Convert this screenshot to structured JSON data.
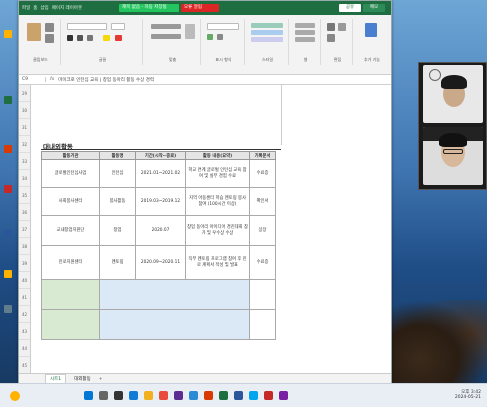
{
  "window": {
    "title_cells": [
      "파일",
      "홈",
      "삽입",
      "페이지 레이아웃",
      "수식",
      "데이터",
      "검토",
      "보기",
      "자동화",
      "도움말"
    ],
    "toast_green": "제목 없음 - 자동 저장됨",
    "toast_red": "오류 알림",
    "share_label": "공유",
    "comment_label": "메모"
  },
  "ribbon": {
    "groups": [
      "클립보드",
      "글꼴",
      "맞춤",
      "표시 형식",
      "스타일",
      "셀",
      "편집",
      "추가 기능"
    ]
  },
  "formula_bar": {
    "name_box": "C9",
    "content": "마이크로 인턴십 교육 | 창업 동아리 활동 수상 경력"
  },
  "sheet": {
    "title": "대내외활동",
    "headers": [
      "활동기관",
      "활동명",
      "기간(시작~종료)",
      "활동 내용(요약)",
      "기록문서"
    ],
    "rows": [
      {
        "org": "글로벌인턴십사업",
        "name": "인턴십",
        "period": "2021.01~2021.02",
        "desc": "학교 연계 글로벌 인턴십 교육 참여 및 실무 경험 수료",
        "doc": "수료증"
      },
      {
        "org": "사회봉사센터",
        "name": "봉사활동",
        "period": "2019.03~2019.12",
        "desc": "지역 아동센터 학습 멘토링 봉사 참여 (100시간 이상)",
        "doc": "확인서"
      },
      {
        "org": "교내창업지원단",
        "name": "창업",
        "period": "2020.07",
        "desc": "창업 동아리 아이디어 경진대회 참가 및 우수상 수상",
        "doc": "상장"
      },
      {
        "org": "진로지원센터",
        "name": "멘토링",
        "period": "2020.09~2020.11",
        "desc": "직무 멘토링 프로그램 참여 후 진로 계획서 작성 및 발표",
        "doc": "수료증"
      }
    ],
    "row_numbers": [
      "29",
      "30",
      "31",
      "32",
      "33",
      "34",
      "35",
      "36",
      "37",
      "38",
      "39",
      "40",
      "41",
      "42",
      "43",
      "44",
      "45"
    ]
  },
  "sheet_tabs": [
    "시트1",
    "대외활동"
  ],
  "taskbar": {
    "time": "오후 3:42",
    "date": "2024-05-21"
  },
  "colors": {
    "excel_green": "#1e6e41",
    "highlight_green": "#d9ead3",
    "highlight_blue": "#dbe9f7"
  }
}
